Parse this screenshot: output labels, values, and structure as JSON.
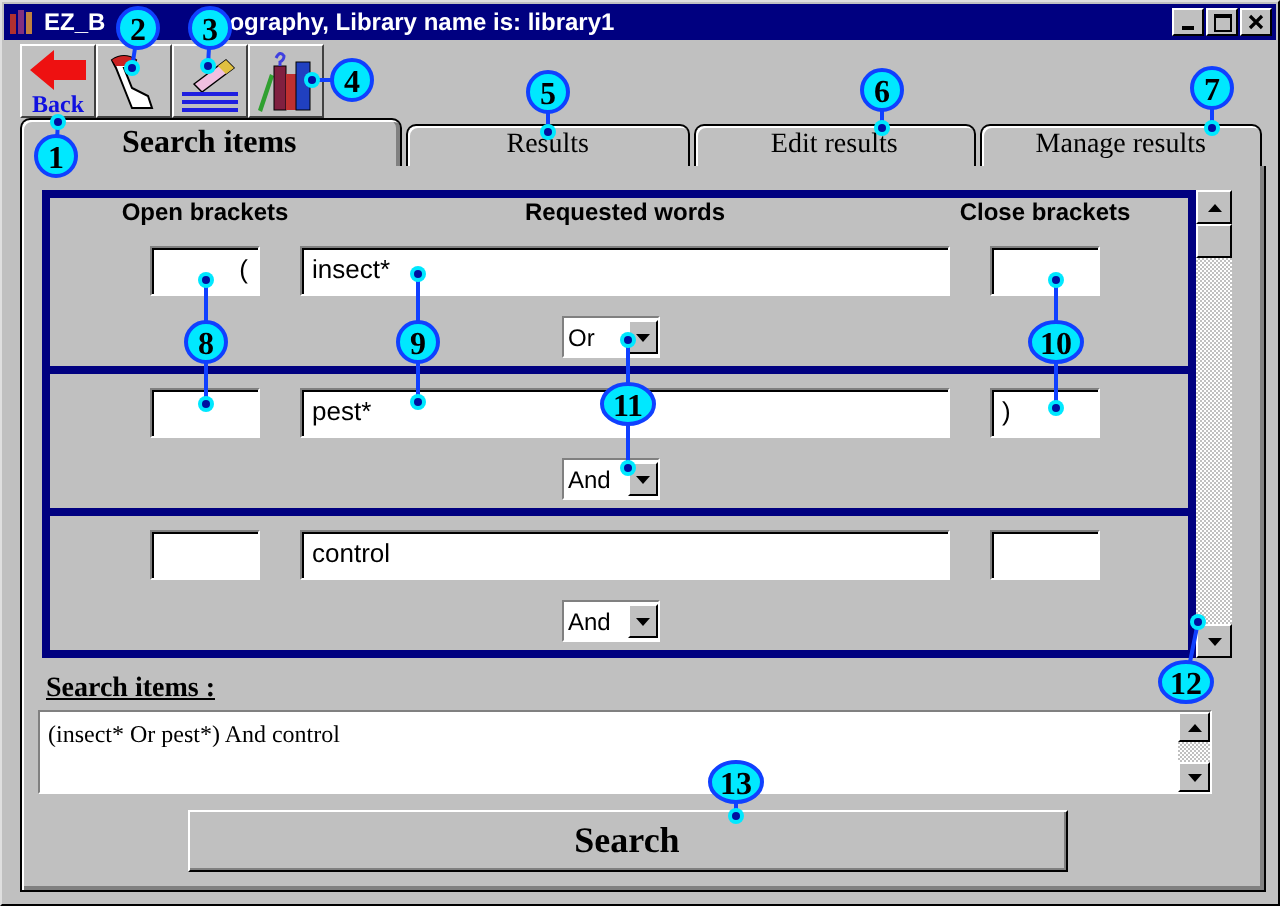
{
  "window": {
    "title_parts": [
      "EZ_B",
      "ography, Library name is: library1"
    ]
  },
  "toolbar": {
    "back_label": "Back"
  },
  "tabs": [
    {
      "label": "Search items",
      "selected": true
    },
    {
      "label": "Results",
      "selected": false
    },
    {
      "label": "Edit results",
      "selected": false
    },
    {
      "label": "Manage results",
      "selected": false
    }
  ],
  "columns": [
    "Open brackets",
    "Requested words",
    "Close brackets"
  ],
  "rows": [
    {
      "open": "(",
      "word": "insect*",
      "close": "",
      "operator": "Or"
    },
    {
      "open": "",
      "word": "pest*",
      "close": ")",
      "operator": "And"
    },
    {
      "open": "",
      "word": "control",
      "close": "",
      "operator": "And"
    }
  ],
  "summary": {
    "label": "Search items :",
    "value": "(insect* Or pest*) And control"
  },
  "search_button": "Search",
  "callouts": [
    "1",
    "2",
    "3",
    "4",
    "5",
    "6",
    "7",
    "8",
    "9",
    "10",
    "11",
    "12",
    "13"
  ]
}
